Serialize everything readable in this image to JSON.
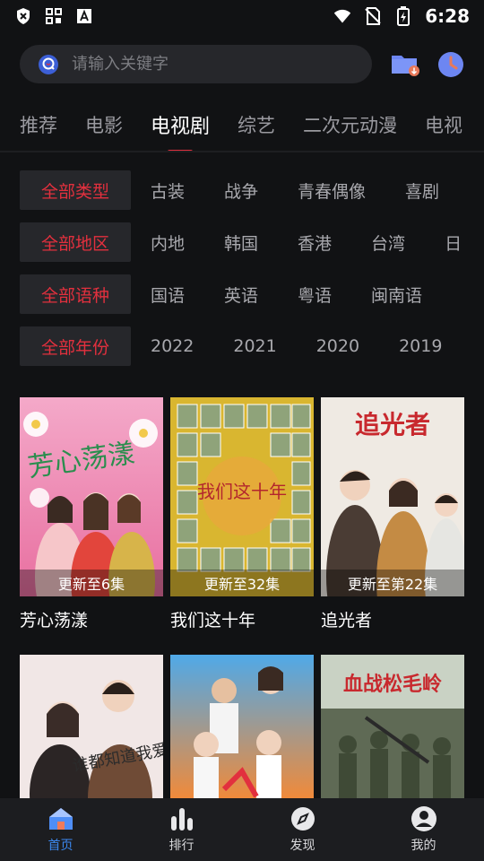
{
  "status": {
    "time": "6:28"
  },
  "search": {
    "placeholder": "请输入关键字"
  },
  "tabs": [
    {
      "label": "推荐"
    },
    {
      "label": "电影"
    },
    {
      "label": "电视剧",
      "active": true
    },
    {
      "label": "综艺"
    },
    {
      "label": "二次元动漫"
    },
    {
      "label": "电视"
    }
  ],
  "filters": {
    "type": {
      "selected": "全部类型",
      "options": [
        "古装",
        "战争",
        "青春偶像",
        "喜剧"
      ]
    },
    "region": {
      "selected": "全部地区",
      "options": [
        "内地",
        "韩国",
        "香港",
        "台湾",
        "日"
      ]
    },
    "lang": {
      "selected": "全部语种",
      "options": [
        "国语",
        "英语",
        "粤语",
        "闽南语"
      ]
    },
    "year": {
      "selected": "全部年份",
      "options": [
        "2022",
        "2021",
        "2020",
        "2019"
      ]
    }
  },
  "posters": [
    {
      "title": "芳心荡漾",
      "update": "更新至6集",
      "art_text": "芳心荡漾"
    },
    {
      "title": "我们这十年",
      "update": "更新至32集",
      "art_text": "我们这十年"
    },
    {
      "title": "追光者",
      "update": "更新至第22集",
      "art_text": "追光者"
    },
    {
      "title": "",
      "update": "",
      "art_text": "谁都知道我爱你"
    },
    {
      "title": "",
      "update": "",
      "art_text": ""
    },
    {
      "title": "",
      "update": "",
      "art_text": "血战松毛岭"
    }
  ],
  "nav": [
    {
      "label": "首页",
      "icon": "home-icon",
      "active": true
    },
    {
      "label": "排行",
      "icon": "chart-bars-icon"
    },
    {
      "label": "发现",
      "icon": "compass-icon"
    },
    {
      "label": "我的",
      "icon": "user-icon"
    }
  ],
  "colors": {
    "accent": "#e2303e",
    "nav_active": "#3b88f0",
    "bg": "#111214"
  }
}
